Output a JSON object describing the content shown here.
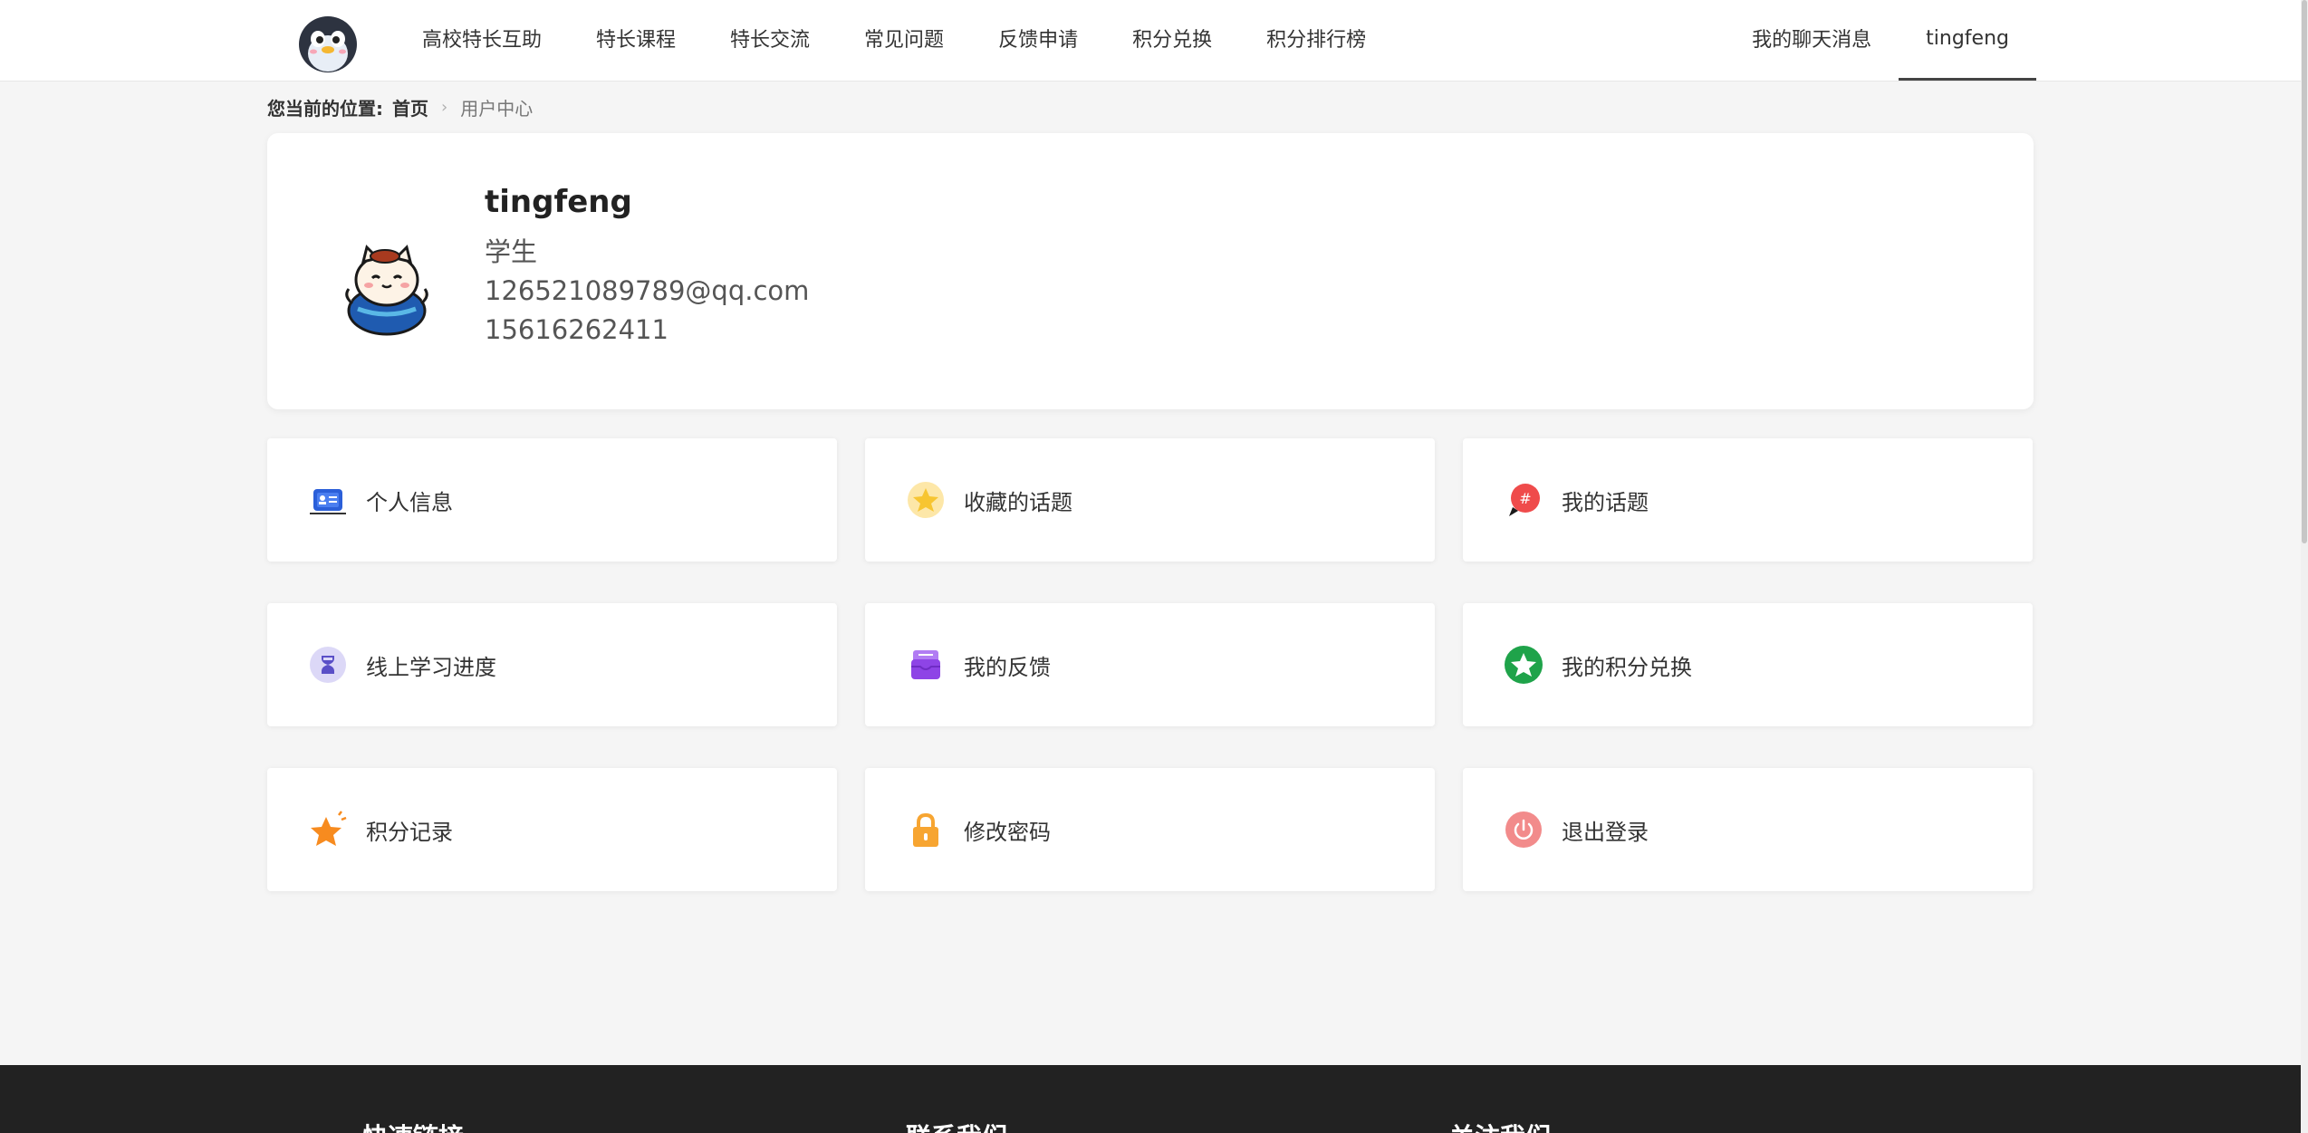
{
  "header": {
    "nav": [
      {
        "label": "高校特长互助"
      },
      {
        "label": "特长课程"
      },
      {
        "label": "特长交流"
      },
      {
        "label": "常见问题"
      },
      {
        "label": "反馈申请"
      },
      {
        "label": "积分兑换"
      },
      {
        "label": "积分排行榜"
      }
    ],
    "messages_label": "我的聊天消息",
    "user_label": "tingfeng"
  },
  "breadcrumb": {
    "label": "您当前的位置:",
    "home": "首页",
    "current": "用户中心"
  },
  "profile": {
    "username": "tingfeng",
    "role": "学生",
    "email": "126521089789@qq.com",
    "phone": "15616262411"
  },
  "menu": [
    {
      "label": "个人信息",
      "icon": "id-card-icon",
      "color": "#2b5fd9"
    },
    {
      "label": "收藏的话题",
      "icon": "star-badge-icon",
      "color": "#f7c531"
    },
    {
      "label": "我的话题",
      "icon": "hashtag-bubble-icon",
      "color": "#ef4b4b"
    },
    {
      "label": "线上学习进度",
      "icon": "hourglass-icon",
      "color": "#7b6fd6"
    },
    {
      "label": "我的反馈",
      "icon": "inbox-icon",
      "color": "#8e44e6"
    },
    {
      "label": "我的积分兑换",
      "icon": "star-circle-icon",
      "color": "#1fa34a"
    },
    {
      "label": "积分记录",
      "icon": "star-sparkle-icon",
      "color": "#f78b1f"
    },
    {
      "label": "修改密码",
      "icon": "lock-icon",
      "color": "#f7a531"
    },
    {
      "label": "退出登录",
      "icon": "power-icon",
      "color": "#f28b8b"
    }
  ],
  "footer": {
    "col1": "快速链接",
    "col2": "联系我们",
    "col3": "关注我们"
  }
}
